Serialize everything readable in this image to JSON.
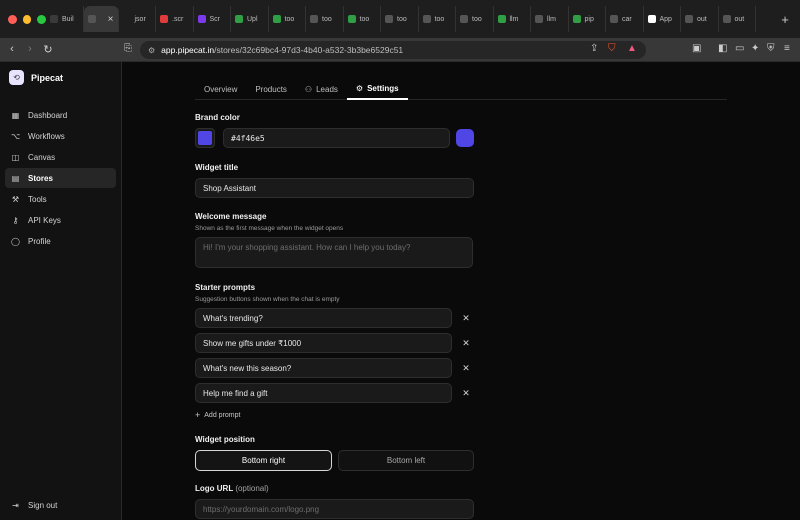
{
  "browser": {
    "tabs": [
      {
        "label": "Buil",
        "color": "#3a3a3a"
      },
      {
        "label": "",
        "color": "#555555",
        "active": true
      },
      {
        "label": "jsor",
        "color": "#1e1e1e"
      },
      {
        "label": ".scr",
        "color": "#e23b3b"
      },
      {
        "label": "Scr",
        "color": "#7c3aed"
      },
      {
        "label": "Upl",
        "color": "#2f9e44"
      },
      {
        "label": "too",
        "color": "#2f9e44"
      },
      {
        "label": "too",
        "color": "#555555"
      },
      {
        "label": "too",
        "color": "#2f9e44"
      },
      {
        "label": "too",
        "color": "#555555"
      },
      {
        "label": "too",
        "color": "#555555"
      },
      {
        "label": "too",
        "color": "#555555"
      },
      {
        "label": "llm",
        "color": "#2f9e44"
      },
      {
        "label": "llm",
        "color": "#555555"
      },
      {
        "label": "pip",
        "color": "#2f9e44"
      },
      {
        "label": "car",
        "color": "#555555"
      },
      {
        "label": "App",
        "color": "#ffffff"
      },
      {
        "label": "out",
        "color": "#555555"
      },
      {
        "label": "out",
        "color": "#555555"
      }
    ],
    "active_tab_close": "×",
    "new_tab": "+",
    "url_host": "app.pipecat.in",
    "url_path": "/stores/32c69bc4-97d3-4b40-a532-3b3be6529c51"
  },
  "sidebar": {
    "brand": "Pipecat",
    "items": [
      {
        "label": "Dashboard",
        "icon": "grid-icon",
        "glyph": "▦"
      },
      {
        "label": "Workflows",
        "icon": "workflow-icon",
        "glyph": "⌥"
      },
      {
        "label": "Canvas",
        "icon": "canvas-icon",
        "glyph": "◫"
      },
      {
        "label": "Stores",
        "icon": "store-icon",
        "glyph": "▤",
        "active": true
      },
      {
        "label": "Tools",
        "icon": "wrench-icon",
        "glyph": "⚒"
      },
      {
        "label": "API Keys",
        "icon": "key-icon",
        "glyph": "⚷"
      },
      {
        "label": "Profile",
        "icon": "user-icon",
        "glyph": "◯"
      }
    ],
    "signout": "Sign out"
  },
  "page_tabs": [
    {
      "label": "Overview"
    },
    {
      "label": "Products"
    },
    {
      "label": "Leads",
      "icon": "users-icon",
      "glyph": "⚇"
    },
    {
      "label": "Settings",
      "icon": "gear-icon",
      "glyph": "⚙",
      "active": true
    }
  ],
  "settings": {
    "brand_color_label": "Brand color",
    "brand_color_value": "#4f46e5",
    "brand_color": "#4f46e5",
    "widget_title_label": "Widget title",
    "widget_title_value": "Shop Assistant",
    "welcome_label": "Welcome message",
    "welcome_hint": "Shown as the first message when the widget opens",
    "welcome_placeholder": "Hi! I'm your shopping assistant. How can I help you today?",
    "starter_label": "Starter prompts",
    "starter_hint": "Suggestion buttons shown when the chat is empty",
    "starter_prompts": [
      "What's trending?",
      "Show me gifts under ₹1000",
      "What's new this season?",
      "Help me find a gift"
    ],
    "remove_glyph": "✕",
    "add_prompt": "Add prompt",
    "position_label": "Widget position",
    "position_options": [
      "Bottom right",
      "Bottom left"
    ],
    "logo_label": "Logo URL",
    "logo_optional": "(optional)",
    "logo_placeholder": "https://yourdomain.com/logo.png"
  }
}
